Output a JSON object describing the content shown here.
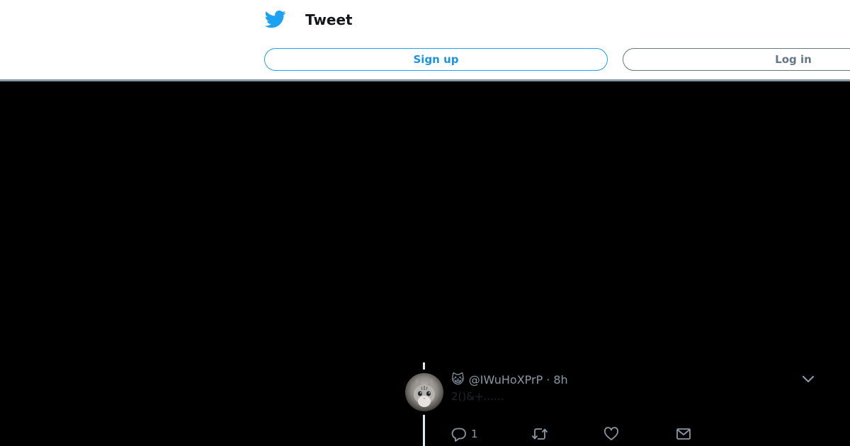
{
  "header": {
    "title": "Tweet",
    "logo_icon": "twitter-bird-icon",
    "signup_label": "Sign up",
    "login_label": "Log in"
  },
  "tweet": {
    "name_emoji": "😺",
    "handle": "@IWuHoXPrP",
    "separator": "·",
    "time": "8h",
    "text": "2()&+......",
    "reply_count": "1"
  },
  "colors": {
    "brand": "#1da1f2",
    "brand_text": "#1b95e0",
    "muted": "#8899a6",
    "background": "#000000",
    "header_background": "#ffffff"
  }
}
